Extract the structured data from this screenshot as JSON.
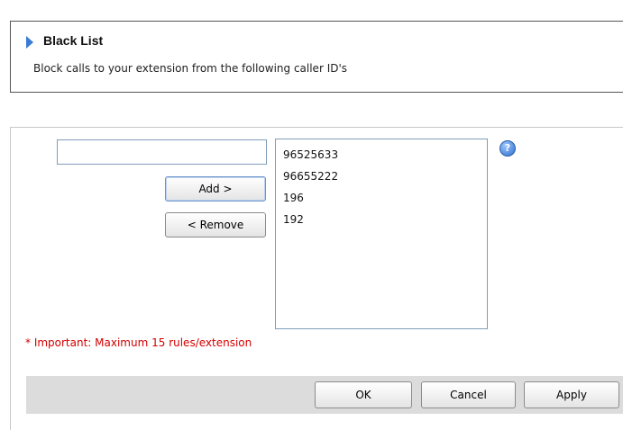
{
  "header": {
    "title": "Black List",
    "description": "Block calls to your extension from the following caller ID's"
  },
  "form": {
    "caller_input_value": "",
    "add_label": "Add >",
    "remove_label": "< Remove",
    "blocked_list": [
      "96525633",
      "96655222",
      "196",
      "192"
    ],
    "help_icon": "?",
    "important_note": "* Important: Maximum 15 rules/extension"
  },
  "footer": {
    "ok_label": "OK",
    "cancel_label": "Cancel",
    "apply_label": "Apply"
  },
  "icons": {
    "header_arrow": "triangle-right-icon",
    "help": "question-circle-icon"
  },
  "colors": {
    "accent": "#3a7bd5",
    "important": "#d40000",
    "footer_bg": "#dcdcdc"
  }
}
